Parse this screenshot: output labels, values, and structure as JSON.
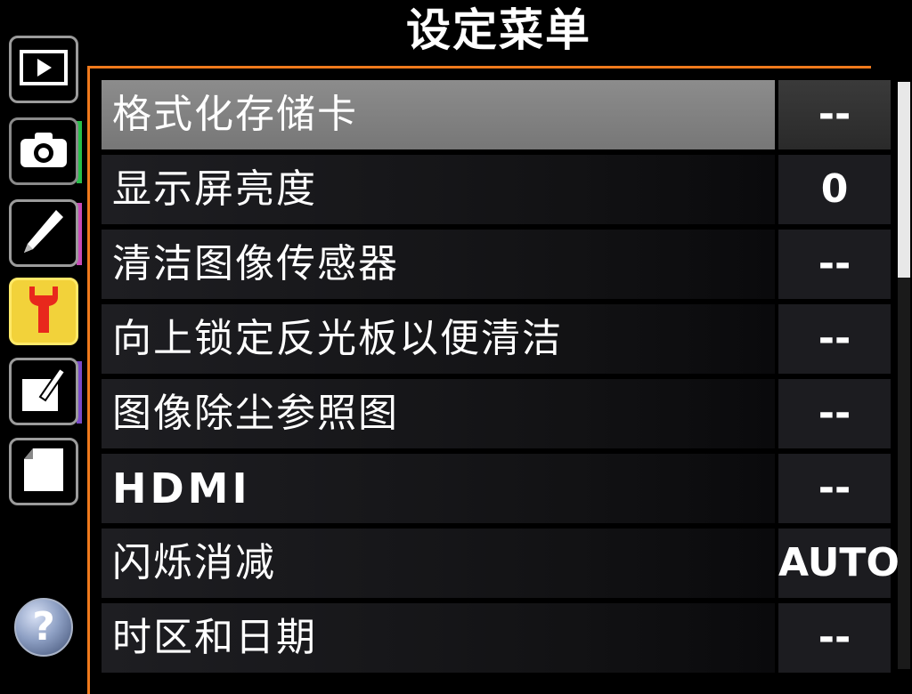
{
  "title": "设定菜单",
  "tabs": [
    {
      "icon": "playback-icon"
    },
    {
      "icon": "camera-icon"
    },
    {
      "icon": "pencil-icon"
    },
    {
      "icon": "wrench-icon"
    },
    {
      "icon": "retouch-icon"
    },
    {
      "icon": "recent-settings-icon"
    }
  ],
  "help": {
    "icon": "help-icon",
    "label": "?"
  },
  "menu": {
    "items": [
      {
        "label": "格式化存储卡",
        "value": "--"
      },
      {
        "label": "显示屏亮度",
        "value": "0"
      },
      {
        "label": "清洁图像传感器",
        "value": "--"
      },
      {
        "label": "向上锁定反光板以便清洁",
        "value": "--"
      },
      {
        "label": "图像除尘参照图",
        "value": "--"
      },
      {
        "label": "HDMI",
        "value": "--"
      },
      {
        "label": "闪烁消减",
        "value": "AUTO"
      },
      {
        "label": "时区和日期",
        "value": "--"
      }
    ]
  },
  "colors": {
    "accent": "#f07a1c",
    "active_tab": "#f2d23a",
    "selected_row": "#8c8c8c"
  }
}
